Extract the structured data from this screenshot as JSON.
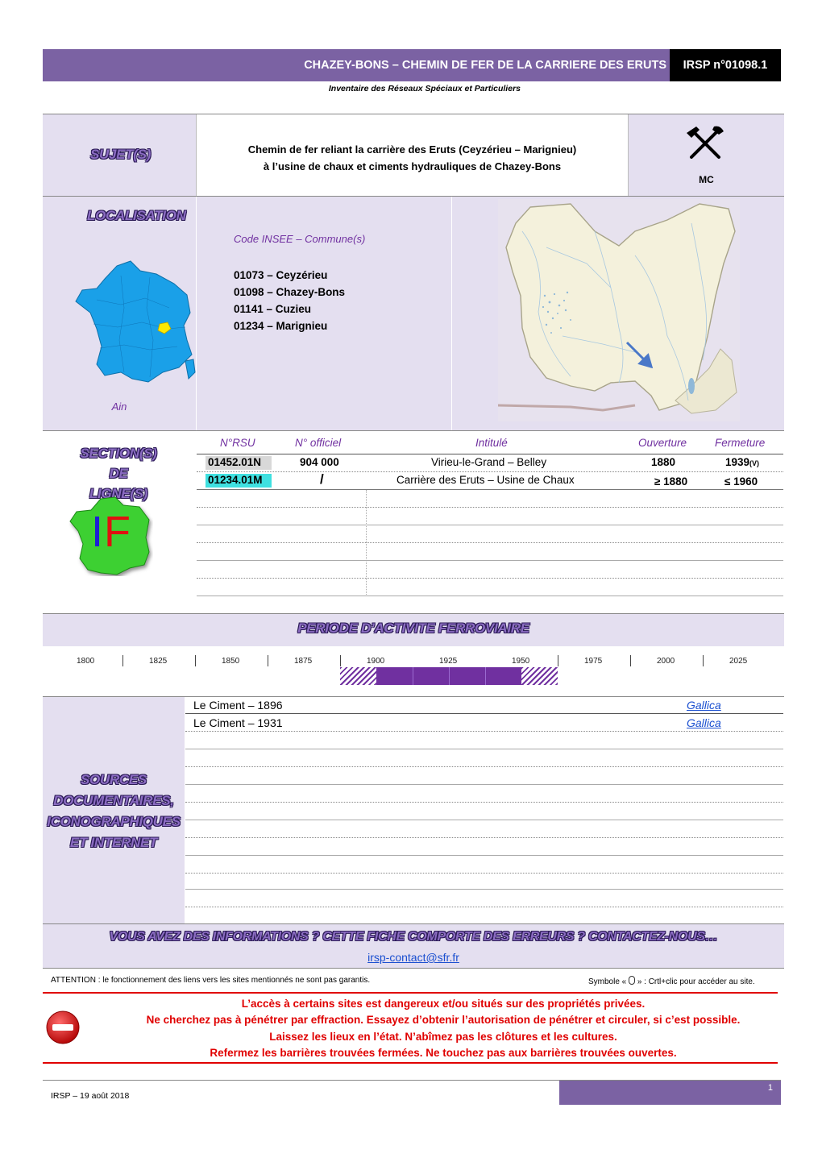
{
  "header": {
    "title": "CHAZEY-BONS – CHEMIN DE FER DE LA CARRIERE DES ERUTS",
    "id": "IRSP n°01098.1",
    "subtitle": "Inventaire des Réseaux Spéciaux et Particuliers"
  },
  "sujet": {
    "title": "SUJET(S)",
    "line1": "Chemin de fer reliant la carrière des Eruts (Ceyzérieu – Marignieu)",
    "line2": "à l’usine de chaux et ciments hydrauliques de Chazey-Bons",
    "icon_label": "MC",
    "icon": "hammer-pick-icon"
  },
  "localisation": {
    "title": "LOCALISATION",
    "code_label": "Code INSEE – Commune(s)",
    "communes": [
      "01073 – Ceyzérieu",
      "01098 – Chazey-Bons",
      "01141 – Cuzieu",
      "01234 – Marignieu"
    ],
    "department": "Ain"
  },
  "sections": {
    "title_line1": "SECTION(S) DE",
    "title_line2": "LIGNE(S)",
    "logo_text_i": "I",
    "logo_text_f": "F",
    "headers": [
      "N°RSU",
      "N° officiel",
      "Intitulé",
      "Ouverture",
      "Fermeture"
    ],
    "rows": [
      {
        "rsu": "01452.01N",
        "officiel": "904 000",
        "intitule": "Virieu-le-Grand – Belley",
        "ouverture": "1880",
        "fermeture": "1939",
        "fermeture_sub": "(V)"
      },
      {
        "rsu": "01234.01M",
        "officiel": "/",
        "intitule": "Carrière des Eruts – Usine de Chaux",
        "ouverture": "≥ 1880",
        "fermeture": "≤ 1960",
        "fermeture_sub": ""
      }
    ]
  },
  "periode": {
    "title": "PERIODE D’ACTIVITE FERROVIAIRE",
    "ticks": [
      "1800",
      "1825",
      "1850",
      "1875",
      "1900",
      "1925",
      "1950",
      "1975",
      "2000",
      "2025"
    ],
    "colors": {
      "active": "#7030a0"
    }
  },
  "sources": {
    "title_lines": [
      "SOURCES",
      "DOCUMENTAIRES,",
      "ICONOGRAPHIQUES",
      "ET INTERNET"
    ],
    "rows": [
      {
        "label": "Le Ciment – 1896",
        "link": "Gallica"
      },
      {
        "label": "Le Ciment – 1931",
        "link": "Gallica"
      }
    ]
  },
  "contact": {
    "title": "VOUS AVEZ DES INFORMATIONS ? CETTE FICHE COMPORTE DES ERREURS ? CONTACTEZ-NOUS…",
    "email": "irsp-contact@sfr.fr",
    "attention": "ATTENTION : le fonctionnement des liens vers les sites mentionnés ne sont pas garantis.",
    "symbol_note_pre": "Symbole «",
    "symbol_note_post": "» : Crtl+clic pour accéder au site."
  },
  "warning": {
    "lines": [
      "L’accès à certains sites est dangereux et/ou situés sur des propriétés privées.",
      "Ne cherchez pas à pénétrer par effraction. Essayez d’obtenir l’autorisation de pénétrer et circuler, si c’est possible.",
      "Laissez les lieux en l’état. N’abîmez pas les clôtures et les cultures.",
      "Refermez les barrières trouvées fermées. Ne touchez pas aux barrières trouvées ouvertes."
    ]
  },
  "footer": {
    "left": "IRSP – 19 août 2018",
    "page": "1"
  }
}
